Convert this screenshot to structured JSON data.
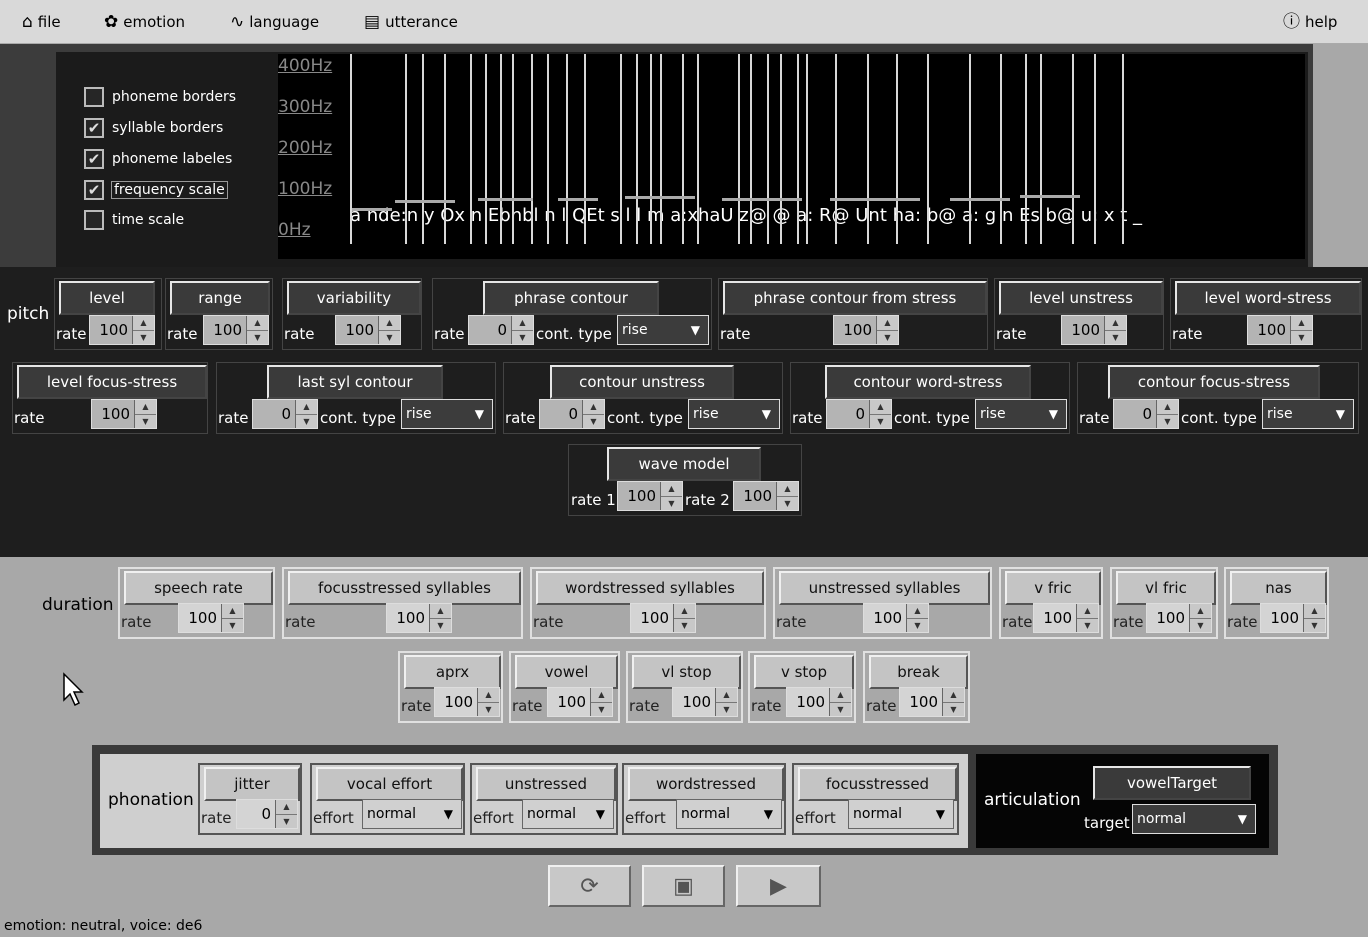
{
  "menu": {
    "file": "file",
    "emotion": "emotion",
    "language": "language",
    "utterance": "utterance",
    "help": "help"
  },
  "display_options": [
    {
      "label": "phoneme borders",
      "checked": false
    },
    {
      "label": "syllable borders",
      "checked": true
    },
    {
      "label": "phoneme labeles",
      "checked": true
    },
    {
      "label": "frequency scale",
      "checked": true
    },
    {
      "label": "time scale",
      "checked": false
    }
  ],
  "frequency_labels": [
    "400Hz",
    "300Hz",
    "200Hz",
    "100Hz",
    "0Hz"
  ],
  "phoneme_string": "a nde:n y Ox n Ebhbl n l QEt s l l m a:xhaU z@ @ a: R@ Unt ha: b@ a: g n Es b@ u: x t _",
  "pitch": {
    "label": "pitch",
    "groups": [
      {
        "button": "level",
        "rate_label": "rate",
        "rate": "100"
      },
      {
        "button": "range",
        "rate_label": "rate",
        "rate": "100"
      },
      {
        "button": "variability",
        "rate_label": "rate",
        "rate": "100"
      },
      {
        "button": "phrase contour",
        "rate_label": "rate",
        "rate": "0",
        "type_label": "cont. type",
        "type": "rise"
      },
      {
        "button": "phrase contour from stress",
        "rate_label": "rate",
        "rate": "100"
      },
      {
        "button": "level unstress",
        "rate_label": "rate",
        "rate": "100"
      },
      {
        "button": "level word-stress",
        "rate_label": "rate",
        "rate": "100"
      },
      {
        "button": "level focus-stress",
        "rate_label": "rate",
        "rate": "100"
      },
      {
        "button": "last syl contour",
        "rate_label": "rate",
        "rate": "0",
        "type_label": "cont. type",
        "type": "rise"
      },
      {
        "button": "contour unstress",
        "rate_label": "rate",
        "rate": "0",
        "type_label": "cont. type",
        "type": "rise"
      },
      {
        "button": "contour word-stress",
        "rate_label": "rate",
        "rate": "0",
        "type_label": "cont. type",
        "type": "rise"
      },
      {
        "button": "contour focus-stress",
        "rate_label": "rate",
        "rate": "0",
        "type_label": "cont. type",
        "type": "rise"
      }
    ],
    "wave_model": {
      "button": "wave model",
      "rate1_label": "rate 1",
      "rate1": "100",
      "rate2_label": "rate 2",
      "rate2": "100"
    }
  },
  "duration": {
    "label": "duration",
    "groups": [
      {
        "button": "speech rate",
        "rate_label": "rate",
        "rate": "100"
      },
      {
        "button": "focusstressed syllables",
        "rate_label": "rate",
        "rate": "100"
      },
      {
        "button": "wordstressed syllables",
        "rate_label": "rate",
        "rate": "100"
      },
      {
        "button": "unstressed syllables",
        "rate_label": "rate",
        "rate": "100"
      },
      {
        "button": "v fric",
        "rate_label": "rate",
        "rate": "100"
      },
      {
        "button": "vl fric",
        "rate_label": "rate",
        "rate": "100"
      },
      {
        "button": "nas",
        "rate_label": "rate",
        "rate": "100"
      },
      {
        "button": "aprx",
        "rate_label": "rate",
        "rate": "100"
      },
      {
        "button": "vowel",
        "rate_label": "rate",
        "rate": "100"
      },
      {
        "button": "vl stop",
        "rate_label": "rate",
        "rate": "100"
      },
      {
        "button": "v stop",
        "rate_label": "rate",
        "rate": "100"
      },
      {
        "button": "break",
        "rate_label": "rate",
        "rate": "100"
      }
    ]
  },
  "phonation": {
    "label": "phonation",
    "groups": [
      {
        "button": "jitter",
        "rate_label": "rate",
        "rate": "0"
      },
      {
        "button": "vocal effort",
        "effort_label": "effort",
        "effort": "normal"
      },
      {
        "button": "unstressed",
        "effort_label": "effort",
        "effort": "normal"
      },
      {
        "button": "wordstressed",
        "effort_label": "effort",
        "effort": "normal"
      },
      {
        "button": "focusstressed",
        "effort_label": "effort",
        "effort": "normal"
      }
    ]
  },
  "articulation": {
    "label": "articulation",
    "button": "vowelTarget",
    "target_label": "target",
    "target": "normal"
  },
  "toolbar": {
    "refresh_icon": "refresh-icon",
    "save_icon": "save-icon",
    "play_icon": "play-icon"
  },
  "status": "emotion: neutral, voice: de6"
}
